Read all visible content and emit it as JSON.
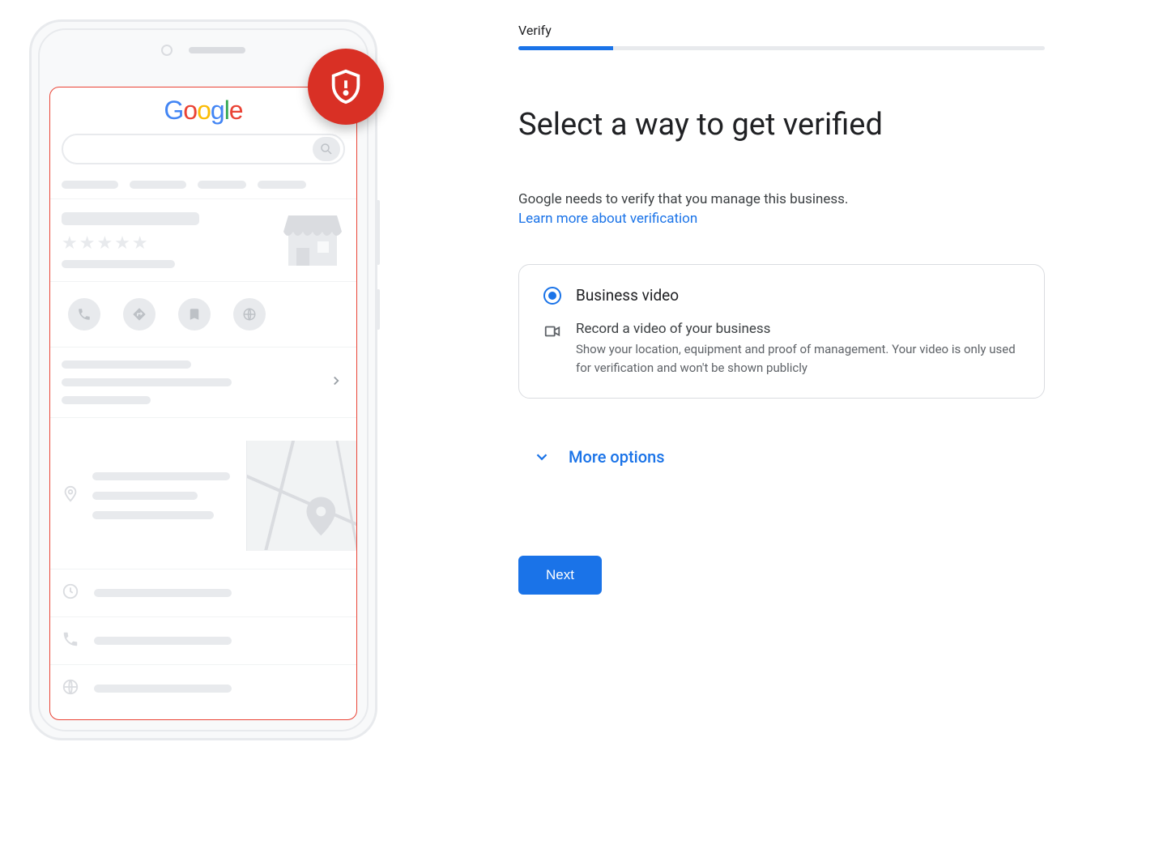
{
  "illustration": {
    "logo_text": "Google",
    "stars": "★★★★★"
  },
  "right": {
    "step_label": "Verify",
    "progress_percent": 18,
    "title": "Select a way to get verified",
    "description": "Google needs to verify that you manage this business.",
    "learn_more": "Learn more about verification",
    "card": {
      "option_label": "Business video",
      "detail_title": "Record a video of your business",
      "detail_text": "Show your location, equipment and proof of management. Your video is only used for verification and won't be shown publicly"
    },
    "more_label": "More options",
    "next_label": "Next"
  }
}
